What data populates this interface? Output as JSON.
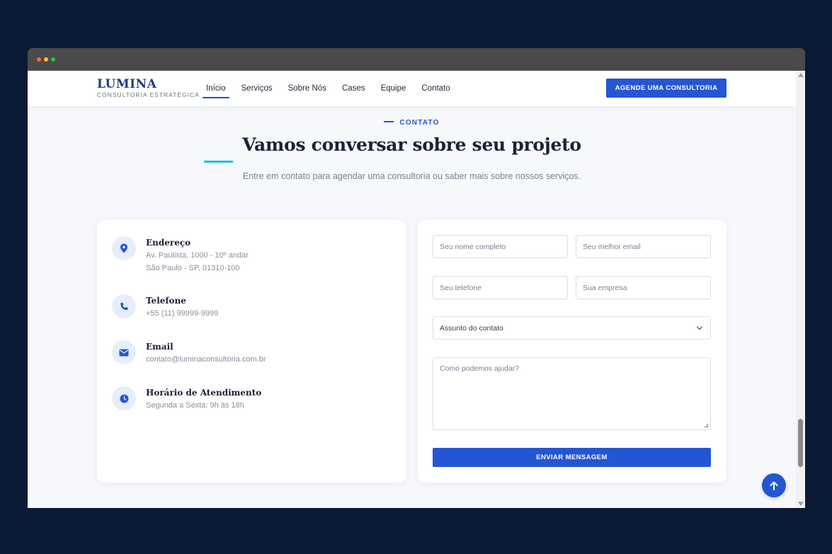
{
  "brand": {
    "name": "LUMINA",
    "tagline": "CONSULTORIA ESTRATÉGICA"
  },
  "nav": {
    "links": [
      "Início",
      "Serviços",
      "Sobre Nós",
      "Cases",
      "Equipe",
      "Contato"
    ],
    "active": "Início",
    "cta_label": "AGENDE UMA CONSULTORIA"
  },
  "section": {
    "eyebrow": "CONTATO",
    "heading": "Vamos conversar sobre seu projeto",
    "subtitle": "Entre em contato para agendar uma consultoria ou saber mais sobre nossos serviços."
  },
  "contact_info": [
    {
      "icon": "map-pin-icon",
      "title": "Endereço",
      "lines": [
        "Av. Paulista, 1000 - 10º andar",
        "São Paulo - SP, 01310-100"
      ]
    },
    {
      "icon": "phone-icon",
      "title": "Telefone",
      "lines": [
        "+55 (11) 99999-9999"
      ]
    },
    {
      "icon": "envelope-icon",
      "title": "Email",
      "lines": [
        "contato@luminaconsultoria.com.br"
      ]
    },
    {
      "icon": "clock-icon",
      "title": "Horário de Atendimento",
      "lines": [
        "Segunda a Sexta: 9h às 18h"
      ]
    }
  ],
  "form": {
    "name_placeholder": "Seu nome completo",
    "email_placeholder": "Seu melhor email",
    "phone_placeholder": "Seu telefone",
    "company_placeholder": "Sua empresa",
    "subject_selected": "Assunto do contato",
    "message_placeholder": "Como podemos ajudar?",
    "submit_label": "ENVIAR MENSAGEM"
  },
  "colors": {
    "page_background": "#0b1a35",
    "primary": "#2456d3",
    "accent": "#22c2d8",
    "heading": "#1a2236"
  }
}
